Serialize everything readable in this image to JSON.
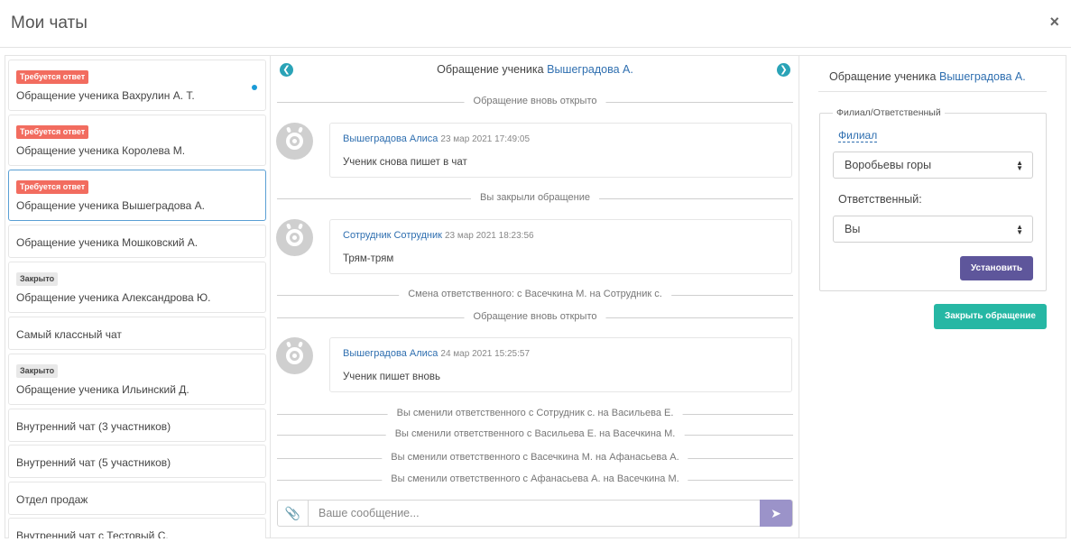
{
  "header": {
    "title": "Мои чаты",
    "close_glyph": "×"
  },
  "chat_list": [
    {
      "badge": "Требуется ответ",
      "badge_color": "#f26c5f",
      "label": "Обращение ученика Вахрулин А. Т.",
      "unread_dot": true,
      "active": false
    },
    {
      "badge": "Требуется ответ",
      "badge_color": "#f26c5f",
      "label": "Обращение ученика Королева М.",
      "unread_dot": false,
      "active": false
    },
    {
      "badge": "Требуется ответ",
      "badge_color": "#f26c5f",
      "label": "Обращение ученика Вышеградова А.",
      "unread_dot": false,
      "active": true
    },
    {
      "badge": "",
      "label": "Обращение ученика Мошковский А.",
      "active": false
    },
    {
      "badge": "Закрыто",
      "badge_color": "#e8e8e8",
      "label": "Обращение ученика Александрова Ю.",
      "active": false
    },
    {
      "badge": "",
      "label": "Самый классный чат",
      "active": false
    },
    {
      "badge": "Закрыто",
      "badge_color": "#e8e8e8",
      "label": "Обращение ученика Ильинский Д.",
      "active": false
    },
    {
      "badge": "",
      "label": "Внутренний чат (3 участников)",
      "active": false
    },
    {
      "badge": "",
      "label": "Внутренний чат (5 участников)",
      "active": false
    },
    {
      "badge": "",
      "label": "Отдел продаж",
      "active": false
    },
    {
      "badge": "",
      "label": "Внутренний чат с Тестовый С.",
      "active": false
    }
  ],
  "conversation": {
    "title_prefix": "Обращение ученика",
    "title_name": "Вышеградова А.",
    "prev_icon": "chevron-left-icon",
    "next_icon": "chevron-right-icon",
    "events": [
      {
        "type": "system",
        "text": "Обращение вновь открыто"
      },
      {
        "type": "message",
        "author": "Вышеградова Алиса",
        "time": "23 мар 2021 17:49:05",
        "text": "Ученик снова пишет в чат"
      },
      {
        "type": "system",
        "text": "Вы закрыли обращение"
      },
      {
        "type": "message",
        "author": "Сотрудник Сотрудник",
        "time": "23 мар 2021 18:23:56",
        "text": "Трям-трям"
      },
      {
        "type": "system",
        "text": "Смена ответственного: с Васечкина М. на Сотрудник с."
      },
      {
        "type": "system",
        "text": "Обращение вновь открыто"
      },
      {
        "type": "message",
        "author": "Вышеградова Алиса",
        "time": "24 мар 2021 15:25:57",
        "text": "Ученик пишет вновь"
      },
      {
        "type": "system",
        "text": "Вы сменили ответственного с Сотрудник с. на Васильева Е."
      },
      {
        "type": "system",
        "text": "Вы сменили ответственного с Васильева Е. на Васечкина М."
      },
      {
        "type": "system",
        "text": "Вы сменили ответственного с Васечкина М. на Афанасьева А."
      },
      {
        "type": "system",
        "text": "Вы сменили ответственного с Афанасьева А. на Васечкина М."
      }
    ],
    "composer": {
      "placeholder": "Ваше сообщение...",
      "attach_icon": "paperclip-icon",
      "send_icon": "send-icon"
    }
  },
  "details": {
    "title_prefix": "Обращение ученика",
    "title_name": "Вышеградова А.",
    "fieldset_legend": "Филиал/Ответственный",
    "branch_link": "Филиал",
    "branch_value": "Воробьевы горы",
    "responsible_label": "Ответственный:",
    "responsible_value": "Вы",
    "set_button": "Установить",
    "close_button": "Закрыть обращение"
  },
  "colors": {
    "accent_teal": "#26b7a4",
    "accent_purple": "#5e569b",
    "badge_red": "#f26c5f",
    "link_blue": "#2f6fb0",
    "send_button": "#9b93c9"
  }
}
